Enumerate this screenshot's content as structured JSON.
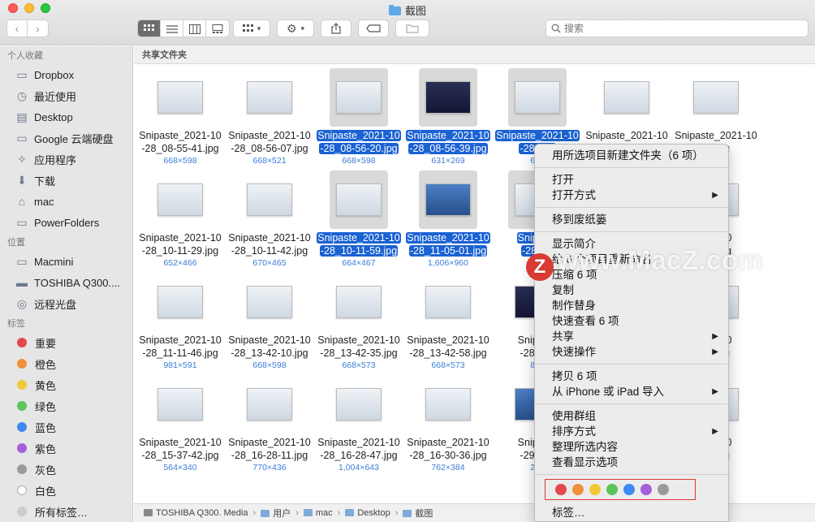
{
  "window": {
    "title": "截图"
  },
  "toolbar": {
    "search_placeholder": "搜索",
    "back": "‹",
    "forward": "›"
  },
  "sidebar": {
    "favorites_header": "个人收藏",
    "favorites": [
      {
        "label": "Dropbox",
        "icon": "folder-icon"
      },
      {
        "label": "最近使用",
        "icon": "recents-icon"
      },
      {
        "label": "Desktop",
        "icon": "desktop-icon"
      },
      {
        "label": "Google 云端硬盘",
        "icon": "folder-icon"
      },
      {
        "label": "应用程序",
        "icon": "applications-icon"
      },
      {
        "label": "下载",
        "icon": "download-icon"
      },
      {
        "label": "mac",
        "icon": "home-icon"
      },
      {
        "label": "PowerFolders",
        "icon": "folder-icon"
      }
    ],
    "locations_header": "位置",
    "locations": [
      {
        "label": "Macmini",
        "icon": "computer-icon"
      },
      {
        "label": "TOSHIBA Q300....",
        "icon": "drive-icon"
      },
      {
        "label": "远程光盘",
        "icon": "disc-icon"
      }
    ],
    "tags_header": "标签",
    "tags": [
      {
        "label": "重要",
        "color": "#e5484d"
      },
      {
        "label": "橙色",
        "color": "#f0903a"
      },
      {
        "label": "黄色",
        "color": "#f2c838"
      },
      {
        "label": "绿色",
        "color": "#5cc55c"
      },
      {
        "label": "蓝色",
        "color": "#3e8af0"
      },
      {
        "label": "紫色",
        "color": "#a65fd8"
      },
      {
        "label": "灰色",
        "color": "#9a9a9a"
      },
      {
        "label": "白色",
        "color": "#ffffff"
      },
      {
        "label": "所有标签…",
        "color": "#cccccc"
      }
    ]
  },
  "main": {
    "path_header": "共享文件夹",
    "files": [
      {
        "line1": "Snipaste_2021-10",
        "line2": "-28_08-55-41.jpg",
        "dims": "668×598",
        "selected": false,
        "style": "light"
      },
      {
        "line1": "Snipaste_2021-10",
        "line2": "-28_08-56-07.jpg",
        "dims": "668×521",
        "selected": false,
        "style": "light"
      },
      {
        "line1": "Snipaste_2021-10",
        "line2": "-28_08-56-20.jpg",
        "dims": "668×598",
        "selected": true,
        "style": "light"
      },
      {
        "line1": "Snipaste_2021-10",
        "line2": "-28_08-56-39.jpg",
        "dims": "631×269",
        "selected": true,
        "style": "dark"
      },
      {
        "line1": "Snipaste_2021-10",
        "line2": "-28_10-",
        "dims": "668",
        "selected": true,
        "style": "light"
      },
      {
        "line1": "Snipaste_2021-10",
        "line2": "",
        "dims": "",
        "selected": false,
        "style": "light"
      },
      {
        "line1": "Snipaste_2021-10",
        "line2": "20.jpg",
        "dims": "35",
        "selected": false,
        "style": "light"
      },
      {
        "line1": "Snipaste_2021-10",
        "line2": "-28_10-11-29.jpg",
        "dims": "652×466",
        "selected": false,
        "style": "light"
      },
      {
        "line1": "Snipaste_2021-10",
        "line2": "-28_10-11-42.jpg",
        "dims": "670×465",
        "selected": false,
        "style": "light"
      },
      {
        "line1": "Snipaste_2021-10",
        "line2": "-28_10-11-59.jpg",
        "dims": "664×467",
        "selected": true,
        "style": "light"
      },
      {
        "line1": "Snipaste_2021-10",
        "line2": "-28_11-05-01.jpg",
        "dims": "1,606×960",
        "selected": true,
        "style": "blue"
      },
      {
        "line1": "Snipaste",
        "line2": "-28_11",
        "dims": "9",
        "selected": true,
        "style": "light"
      },
      {
        "line1": "",
        "line2": "",
        "dims": "",
        "selected": false,
        "style": "light"
      },
      {
        "line1": "021-10",
        "line2": "-49.jpg",
        "dims": "02",
        "selected": false,
        "style": "light"
      },
      {
        "line1": "Snipaste_2021-10",
        "line2": "-28_11-11-46.jpg",
        "dims": "981×591",
        "selected": false,
        "style": "light"
      },
      {
        "line1": "Snipaste_2021-10",
        "line2": "-28_13-42-10.jpg",
        "dims": "668×598",
        "selected": false,
        "style": "light"
      },
      {
        "line1": "Snipaste_2021-10",
        "line2": "-28_13-42-35.jpg",
        "dims": "668×573",
        "selected": false,
        "style": "light"
      },
      {
        "line1": "Snipaste_2021-10",
        "line2": "-28_13-42-58.jpg",
        "dims": "668×573",
        "selected": false,
        "style": "light"
      },
      {
        "line1": "Snipaste",
        "line2": "-28_15-",
        "dims": "804",
        "selected": false,
        "style": "dark"
      },
      {
        "line1": "",
        "line2": "",
        "dims": "",
        "selected": false,
        "style": "light"
      },
      {
        "line1": "021-10",
        "line2": "22.jpg",
        "dims": "98",
        "selected": false,
        "style": "light"
      },
      {
        "line1": "Snipaste_2021-10",
        "line2": "-28_15-37-42.jpg",
        "dims": "564×340",
        "selected": false,
        "style": "light"
      },
      {
        "line1": "Snipaste_2021-10",
        "line2": "-28_16-28-11.jpg",
        "dims": "770×436",
        "selected": false,
        "style": "light"
      },
      {
        "line1": "Snipaste_2021-10",
        "line2": "-28_16-28-47.jpg",
        "dims": "1,004×643",
        "selected": false,
        "style": "light"
      },
      {
        "line1": "Snipaste_2021-10",
        "line2": "-28_16-30-36.jpg",
        "dims": "762×384",
        "selected": false,
        "style": "light"
      },
      {
        "line1": "Snipaste",
        "line2": "-29_09-",
        "dims": "204",
        "selected": false,
        "style": "blue"
      },
      {
        "line1": "",
        "line2": "",
        "dims": "",
        "selected": false,
        "style": "light"
      },
      {
        "line1": "021-10",
        "line2": "58.jpg",
        "dims": "74",
        "selected": false,
        "style": "light"
      }
    ]
  },
  "statusbar": {
    "path": [
      "TOSHIBA Q300. Media",
      "用户",
      "mac",
      "Desktop",
      "截图"
    ],
    "sep": "›"
  },
  "context_menu": {
    "items": [
      {
        "label": "用所选项目新建文件夹（6 项）",
        "arrow": false,
        "sep_after": true
      },
      {
        "label": "打开",
        "arrow": false,
        "sep_after": false
      },
      {
        "label": "打开方式",
        "arrow": true,
        "sep_after": true
      },
      {
        "label": "移到废纸篓",
        "arrow": false,
        "sep_after": true
      },
      {
        "label": "显示简介",
        "arrow": false,
        "sep_after": false
      },
      {
        "label": "给 6 个项目重新命名…",
        "arrow": false,
        "sep_after": false
      },
      {
        "label": "压缩 6 项",
        "arrow": false,
        "sep_after": false
      },
      {
        "label": "复制",
        "arrow": false,
        "sep_after": false
      },
      {
        "label": "制作替身",
        "arrow": false,
        "sep_after": false
      },
      {
        "label": "快速查看 6 项",
        "arrow": false,
        "sep_after": false
      },
      {
        "label": "共享",
        "arrow": true,
        "sep_after": false
      },
      {
        "label": "快速操作",
        "arrow": true,
        "sep_after": true
      },
      {
        "label": "拷贝 6 项",
        "arrow": false,
        "sep_after": false
      },
      {
        "label": "从 iPhone 或 iPad 导入",
        "arrow": true,
        "sep_after": true
      },
      {
        "label": "使用群组",
        "arrow": false,
        "sep_after": false
      },
      {
        "label": "排序方式",
        "arrow": true,
        "sep_after": false
      },
      {
        "label": "整理所选内容",
        "arrow": false,
        "sep_after": false
      },
      {
        "label": "查看显示选项",
        "arrow": false,
        "sep_after": true
      }
    ],
    "tag_colors": [
      "#e5484d",
      "#f0903a",
      "#f2c838",
      "#5cc55c",
      "#3e8af0",
      "#a65fd8",
      "#9a9a9a"
    ],
    "tags_label": "标签…"
  },
  "watermark": {
    "text": "www.MacZ.com",
    "badge": "Z"
  }
}
